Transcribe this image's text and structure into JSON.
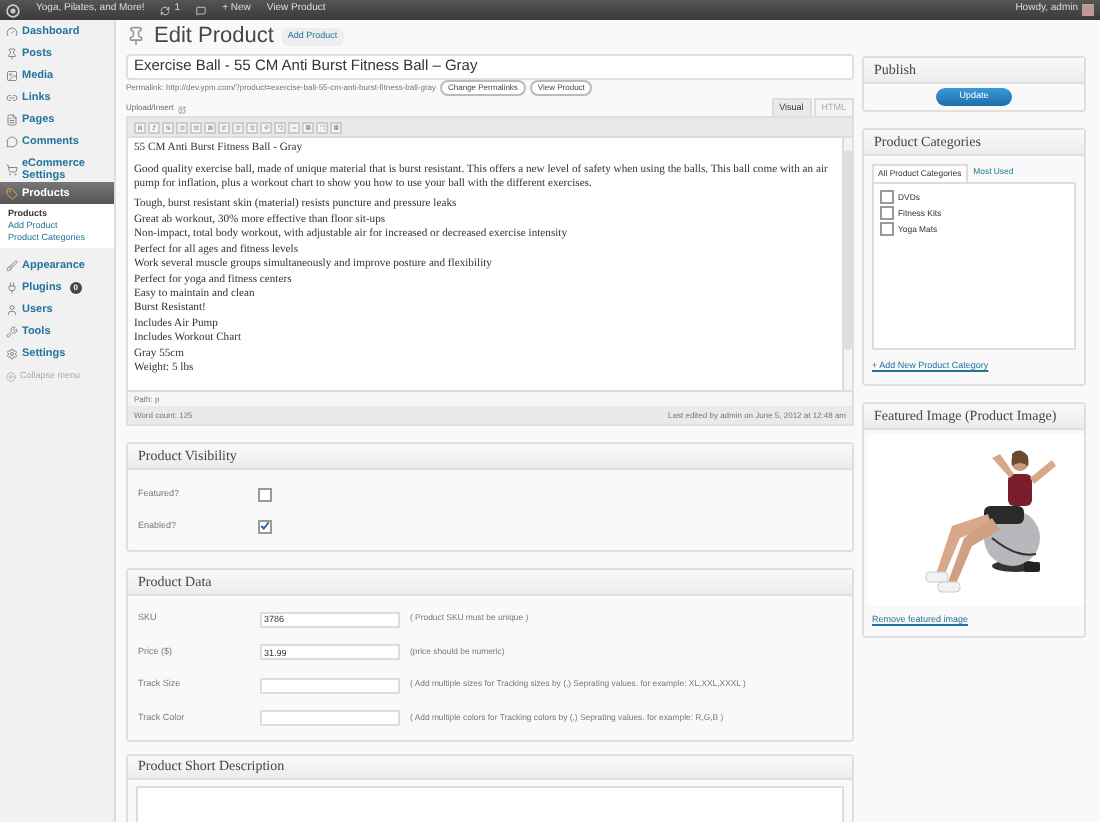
{
  "admin_bar": {
    "site": "Yoga, Pilates, and More!",
    "updates": "1",
    "new": "+ New",
    "view": "View Product",
    "howdy": "Howdy, admin"
  },
  "sidebar": {
    "items": [
      {
        "label": "Dashboard",
        "kind": "dashboard",
        "selected": false
      },
      {
        "label": "Posts",
        "kind": "posts",
        "selected": false
      },
      {
        "label": "Media",
        "kind": "media",
        "selected": false
      },
      {
        "label": "Links",
        "kind": "links",
        "selected": false
      },
      {
        "label": "Pages",
        "kind": "pages",
        "selected": false
      },
      {
        "label": "Comments",
        "kind": "comments",
        "selected": false
      },
      {
        "label": "eCommerce Settings",
        "kind": "ecommerce",
        "selected": false
      },
      {
        "label": "Products",
        "kind": "products",
        "selected": true,
        "children": [
          {
            "label": "Products",
            "selected": true
          },
          {
            "label": "Add Product",
            "selected": false
          },
          {
            "label": "Product Categories",
            "selected": false
          }
        ]
      },
      {
        "label": "Appearance",
        "kind": "appearance",
        "selected": false
      },
      {
        "label": "Plugins",
        "kind": "plugins",
        "selected": false,
        "badge": "0"
      },
      {
        "label": "Users",
        "kind": "users",
        "selected": false
      },
      {
        "label": "Tools",
        "kind": "tools",
        "selected": false
      },
      {
        "label": "Settings",
        "kind": "settings",
        "selected": false
      }
    ],
    "collapse": "Collapse menu"
  },
  "page": {
    "title": "Edit Product",
    "add_button": "Add Product"
  },
  "post_title": "Exercise Ball - 55 CM Anti Burst Fitness Ball – Gray",
  "permalink": {
    "label": "Permalink:",
    "url": "http://dev.ypm.com/?product=exercise-ball-55-cm-anti-burst-fitness-ball-gray",
    "buttons": [
      "Change Permalinks",
      "View Product"
    ]
  },
  "editor": {
    "upload_label": "Upload/Insert",
    "tabs": [
      {
        "label": "Visual",
        "selected": true
      },
      {
        "label": "HTML",
        "selected": false
      }
    ],
    "paragraphs": [
      [
        "55 CM Anti Burst Fitness Ball - Gray"
      ],
      [
        "Good quality exercise ball, made of unique material that is burst resistant. This offers a new level of safety when using the balls. This ball come with an air pump for inflation, plus a workout chart to show you how to use your ball with the different exercises."
      ],
      [
        "Tough, burst resistant skin (material) resists puncture and pressure leaks",
        "Great ab workout, 30% more effective than floor sit-ups",
        "Non-impact, total body workout, with adjustable air for increased or decreased exercise intensity",
        "Perfect for all ages and fitness levels",
        "Work several muscle groups simultaneously and improve posture and flexibility",
        "Perfect for yoga and fitness centers",
        "Easy to maintain and clean",
        "Burst Resistant!",
        "Includes Air Pump",
        "Includes Workout Chart",
        "Gray 55cm",
        "Weight: 5 lbs"
      ]
    ],
    "path": "Path: p",
    "word_count": "Word count: 125",
    "last_edited": "Last edited by admin on June 5, 2012 at 12:48 am"
  },
  "visibility": {
    "title": "Product Visibility",
    "fields": [
      {
        "label": "Featured?",
        "checked": false
      },
      {
        "label": "Enabled?",
        "checked": true
      }
    ]
  },
  "product_data": {
    "title": "Product Data",
    "fields": [
      {
        "label": "SKU",
        "value": "3786",
        "hint": "( Product SKU must be unique )"
      },
      {
        "label": "Price ($)",
        "value": "31.99",
        "hint": "(price should be numeric)"
      },
      {
        "label": "Track Size",
        "hint": "( Add multiple sizes for Tracking sizes by (,) Seprating values. for example: XL,XXL,XXXL )"
      },
      {
        "label": "Track Color",
        "hint": "( Add multiple colors for Tracking colors by (,) Seprating values. for example: R,G,B )"
      }
    ]
  },
  "short_description": {
    "title": "Product Short Description"
  },
  "publish": {
    "title": "Publish",
    "button": "Update"
  },
  "categories": {
    "title": "Product Categories",
    "tabs": [
      {
        "label": "All Product Categories",
        "selected": true
      },
      {
        "label": "Most Used",
        "selected": false
      }
    ],
    "items": [
      {
        "label": "DVDs",
        "checked": false
      },
      {
        "label": "Fitness Kits",
        "checked": false
      },
      {
        "label": "Yoga Mats",
        "checked": false
      }
    ],
    "add_link": "+ Add New Product Category"
  },
  "featured_image": {
    "title": "Featured Image (Product Image)",
    "remove_link": "Remove featured image"
  }
}
